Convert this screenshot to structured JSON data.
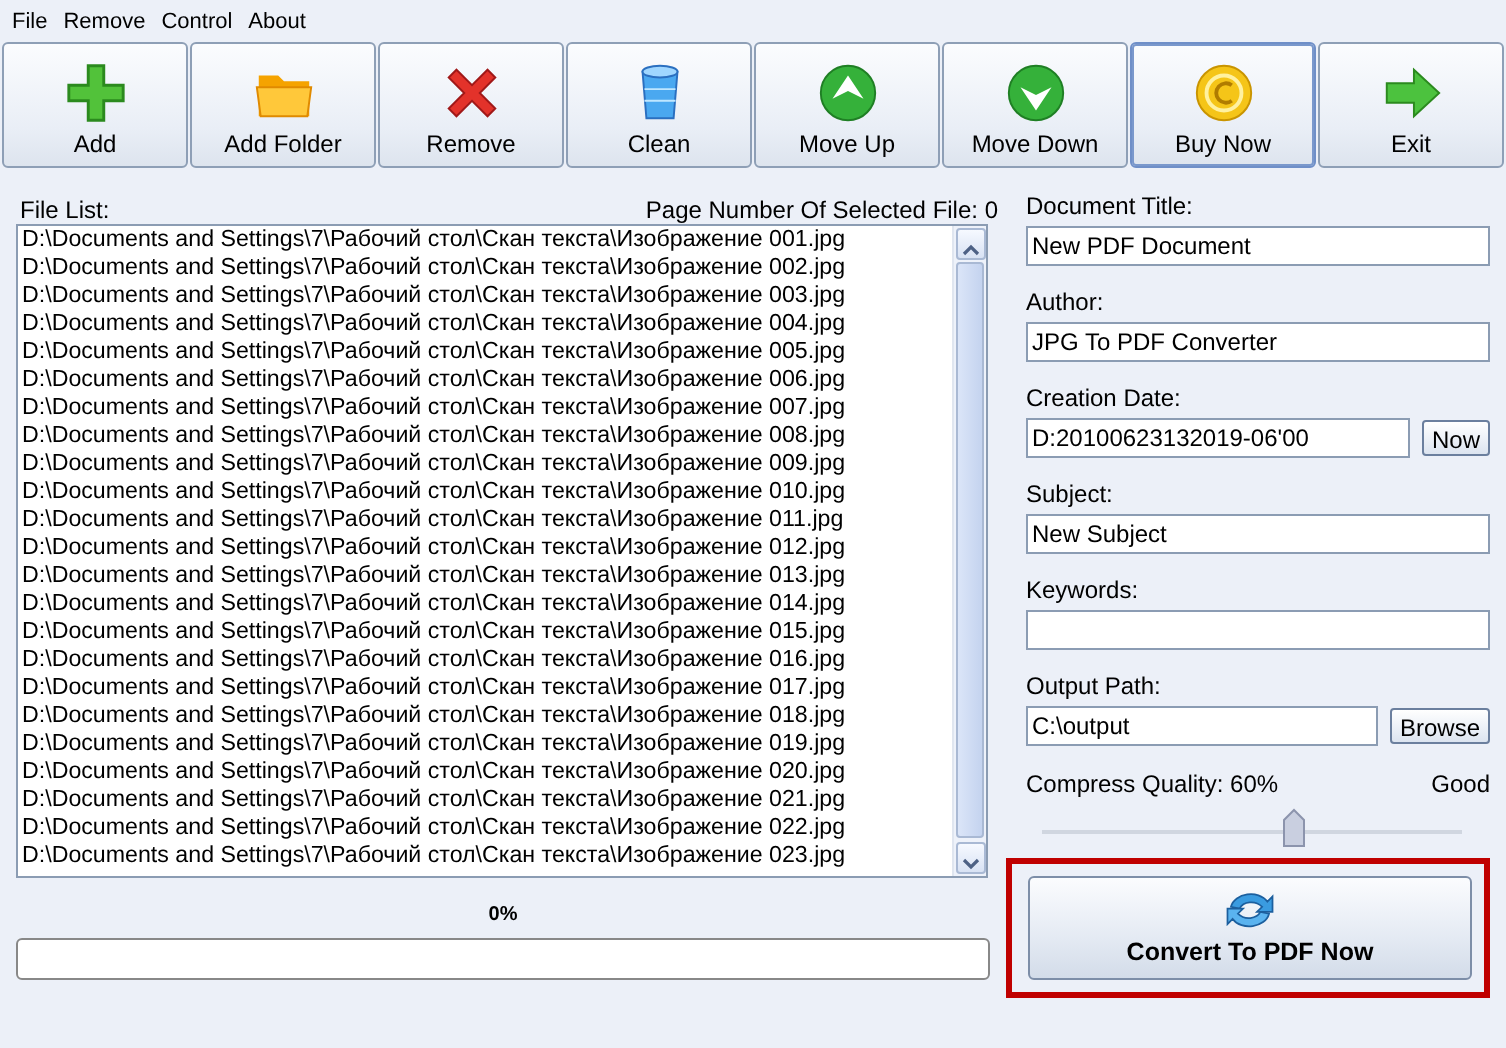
{
  "menu": [
    "File",
    "Remove",
    "Control",
    "About"
  ],
  "toolbar": [
    {
      "kind": "add",
      "label": "Add",
      "focused": false
    },
    {
      "kind": "folder",
      "label": "Add Folder",
      "focused": false
    },
    {
      "kind": "remove",
      "label": "Remove",
      "focused": false
    },
    {
      "kind": "clean",
      "label": "Clean",
      "focused": false
    },
    {
      "kind": "up",
      "label": "Move Up",
      "focused": false
    },
    {
      "kind": "down",
      "label": "Move Down",
      "focused": false
    },
    {
      "kind": "buy",
      "label": "Buy Now",
      "focused": true
    },
    {
      "kind": "exit",
      "label": "Exit",
      "focused": false
    }
  ],
  "file_list": {
    "label": "File List:",
    "page_number": "Page Number Of Selected File: 0",
    "rows": [
      "D:\\Documents and Settings\\7\\Рабочий стол\\Скан текста\\Изображение 001.jpg",
      "D:\\Documents and Settings\\7\\Рабочий стол\\Скан текста\\Изображение 002.jpg",
      "D:\\Documents and Settings\\7\\Рабочий стол\\Скан текста\\Изображение 003.jpg",
      "D:\\Documents and Settings\\7\\Рабочий стол\\Скан текста\\Изображение 004.jpg",
      "D:\\Documents and Settings\\7\\Рабочий стол\\Скан текста\\Изображение 005.jpg",
      "D:\\Documents and Settings\\7\\Рабочий стол\\Скан текста\\Изображение 006.jpg",
      "D:\\Documents and Settings\\7\\Рабочий стол\\Скан текста\\Изображение 007.jpg",
      "D:\\Documents and Settings\\7\\Рабочий стол\\Скан текста\\Изображение 008.jpg",
      "D:\\Documents and Settings\\7\\Рабочий стол\\Скан текста\\Изображение 009.jpg",
      "D:\\Documents and Settings\\7\\Рабочий стол\\Скан текста\\Изображение 010.jpg",
      "D:\\Documents and Settings\\7\\Рабочий стол\\Скан текста\\Изображение 011.jpg",
      "D:\\Documents and Settings\\7\\Рабочий стол\\Скан текста\\Изображение 012.jpg",
      "D:\\Documents and Settings\\7\\Рабочий стол\\Скан текста\\Изображение 013.jpg",
      "D:\\Documents and Settings\\7\\Рабочий стол\\Скан текста\\Изображение 014.jpg",
      "D:\\Documents and Settings\\7\\Рабочий стол\\Скан текста\\Изображение 015.jpg",
      "D:\\Documents and Settings\\7\\Рабочий стол\\Скан текста\\Изображение 016.jpg",
      "D:\\Documents and Settings\\7\\Рабочий стол\\Скан текста\\Изображение 017.jpg",
      "D:\\Documents and Settings\\7\\Рабочий стол\\Скан текста\\Изображение 018.jpg",
      "D:\\Documents and Settings\\7\\Рабочий стол\\Скан текста\\Изображение 019.jpg",
      "D:\\Documents and Settings\\7\\Рабочий стол\\Скан текста\\Изображение 020.jpg",
      "D:\\Documents and Settings\\7\\Рабочий стол\\Скан текста\\Изображение 021.jpg",
      "D:\\Documents and Settings\\7\\Рабочий стол\\Скан текста\\Изображение 022.jpg",
      "D:\\Documents and Settings\\7\\Рабочий стол\\Скан текста\\Изображение 023.jpg"
    ]
  },
  "progress": {
    "reading": "0%",
    "level": 0
  },
  "fields": [
    {
      "label": "Document Title:",
      "value": "New PDF Document"
    },
    {
      "label": "Author:",
      "value": "JPG To PDF Converter"
    },
    {
      "label": "Creation Date:",
      "value": "D:20100623132019-06'00",
      "button": "Now"
    },
    {
      "label": "Subject:",
      "value": "New Subject"
    },
    {
      "label": "Keywords:"
    },
    {
      "label": "Output Path:",
      "value": "C:\\output",
      "button": "Browse"
    }
  ],
  "quality": {
    "label": "Compress Quality: 60%",
    "reading": "Good",
    "level": 0.6
  },
  "convert": {
    "label": "Convert To PDF Now",
    "highlighted": true
  }
}
